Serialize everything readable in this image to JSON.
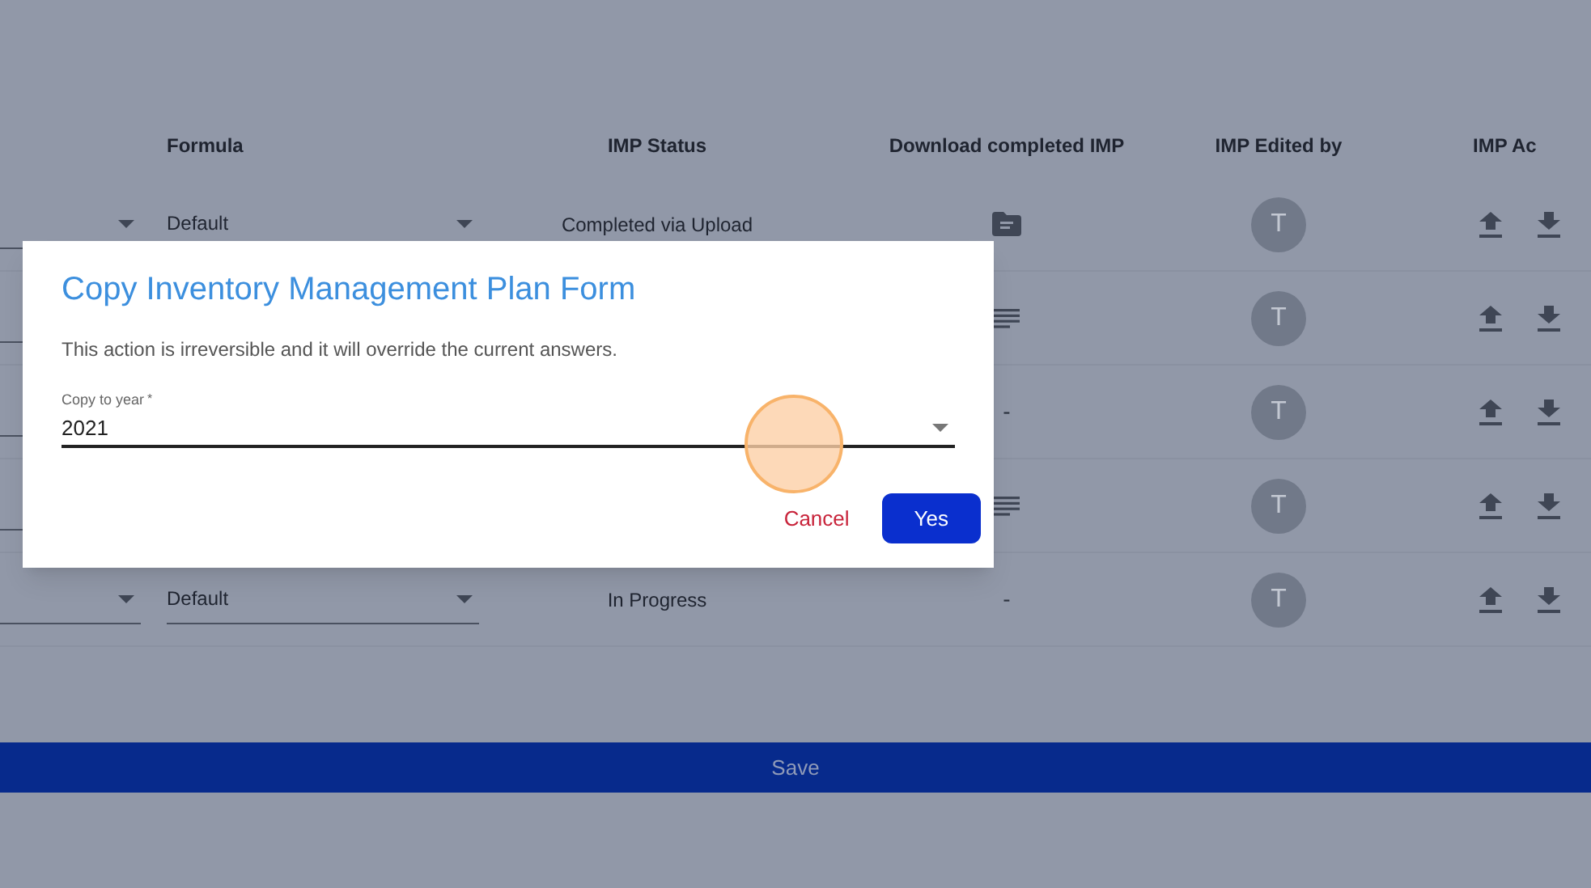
{
  "table": {
    "columns": [
      "",
      "Formula",
      "IMP Status",
      "Download completed IMP",
      "IMP Edited by",
      "IMP Ac"
    ],
    "rows": [
      {
        "formula": "Default",
        "status": "Completed via Upload",
        "download": {
          "kind": "folder"
        },
        "editor": "T"
      },
      {
        "download": {
          "kind": "document"
        },
        "editor": "T"
      },
      {
        "download": {
          "kind": "none",
          "text": "-"
        },
        "editor": "T"
      },
      {
        "download": {
          "kind": "document"
        },
        "editor": "T"
      },
      {
        "formula": "Default",
        "status": "In Progress",
        "download": {
          "kind": "none",
          "text": "-"
        },
        "editor": "T"
      }
    ]
  },
  "save_button": "Save",
  "dialog": {
    "title": "Copy Inventory Management Plan Form",
    "message": "This action is irreversible and it will override the current answers.",
    "field": {
      "label": "Copy to year",
      "required_mark": "*",
      "value": "2021"
    },
    "buttons": [
      {
        "label": "Cancel",
        "kind": "text"
      },
      {
        "label": "Yes",
        "kind": "primary"
      }
    ]
  }
}
